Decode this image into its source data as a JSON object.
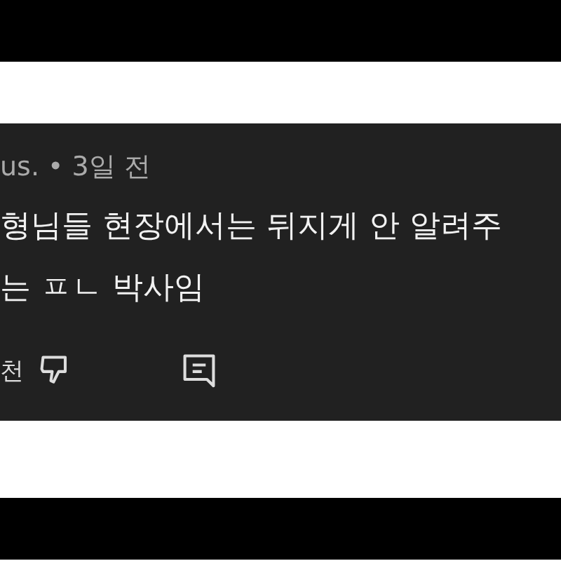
{
  "comment": {
    "meta": "us. • 3일 전",
    "lines": [
      "형님들 현장에서는 뒤지게 안 알려주",
      "는 ㅍㄴ 박사임"
    ],
    "actions": {
      "recommend_label": "천"
    }
  }
}
